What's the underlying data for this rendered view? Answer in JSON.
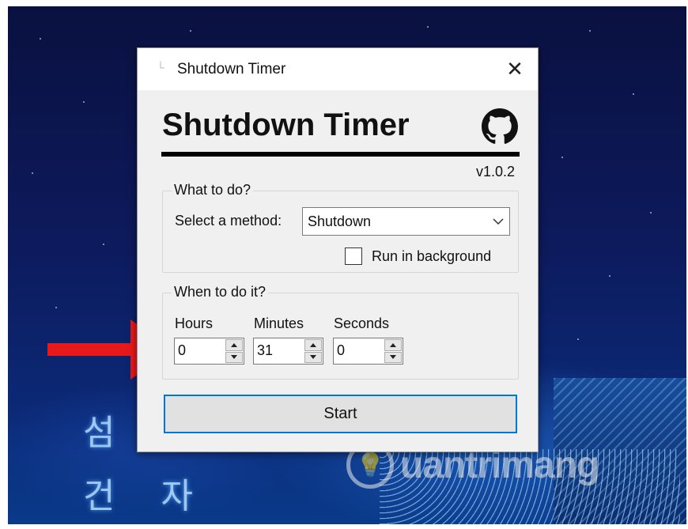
{
  "window": {
    "title": "Shutdown Timer",
    "close_glyph": "✕"
  },
  "app": {
    "heading": "Shutdown Timer",
    "version": "v1.0.2",
    "icons": {
      "github": "github-icon",
      "close": "close-icon",
      "dropdown": "chevron-down-icon"
    }
  },
  "what_group": {
    "legend": "What to do?",
    "method_label": "Select a method:",
    "method_value": "Shutdown",
    "run_in_background_label": "Run in background",
    "run_in_background_checked": false
  },
  "when_group": {
    "legend": "When to do it?",
    "hours_label": "Hours",
    "minutes_label": "Minutes",
    "seconds_label": "Seconds",
    "hours_value": "0",
    "minutes_value": "31",
    "seconds_value": "0"
  },
  "start_label": "Start",
  "background": {
    "korean_text": "섬 꽃 길 건 자",
    "watermark": "uantrimang"
  },
  "colors": {
    "focus_border": "#0078d7",
    "arrow": "#e8191b"
  }
}
